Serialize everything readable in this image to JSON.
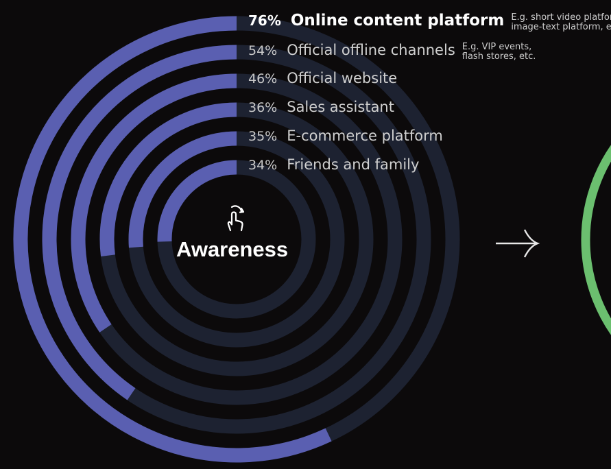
{
  "stage": {
    "title": "Awareness",
    "icon": "touch-hand-icon",
    "next_icon": "arrow-right-icon"
  },
  "colors": {
    "background": "#0c0a0b",
    "filled": "#5a5fb1",
    "track": "#1d2231",
    "next_stage_ring": "#6bbf6f"
  },
  "chart_data": {
    "type": "radial-bar",
    "title": "Awareness",
    "unit": "%",
    "max": 100,
    "items": [
      {
        "label": "Online content platform",
        "value": 76,
        "value_text": "76%",
        "note": [
          "E.g. short video platform,",
          "image-text platform, etc."
        ],
        "highlight": true
      },
      {
        "label": "Official offline channels",
        "value": 54,
        "value_text": "54%",
        "note": [
          "E.g. VIP events,",
          "flash stores, etc."
        ],
        "highlight": false
      },
      {
        "label": "Official website",
        "value": 46,
        "value_text": "46%",
        "note": [],
        "highlight": false
      },
      {
        "label": "Sales assistant",
        "value": 36,
        "value_text": "36%",
        "note": [],
        "highlight": false
      },
      {
        "label": "E-commerce platform",
        "value": 35,
        "value_text": "35%",
        "note": [],
        "highlight": false
      },
      {
        "label": "Friends and family",
        "value": 34,
        "value_text": "34%",
        "note": [],
        "highlight": false
      }
    ]
  }
}
